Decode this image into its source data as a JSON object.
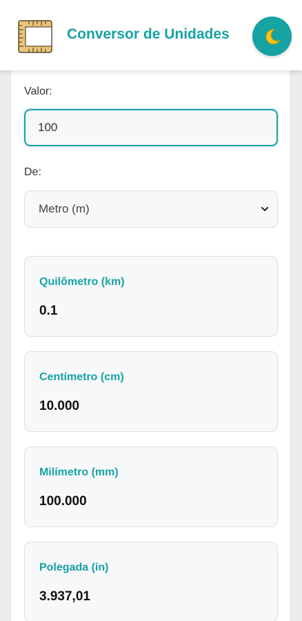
{
  "header": {
    "title": "Conversor de Unidades",
    "logo_icon": "ruler-icon",
    "theme_toggle_icon": "crescent-moon-icon"
  },
  "form": {
    "value_label": "Valor:",
    "value": "100",
    "from_label": "De:",
    "from_selected": "Metro (m)"
  },
  "results": [
    {
      "unit": "Quilômetro (km)",
      "value": "0.1"
    },
    {
      "unit": "Centímetro (cm)",
      "value": "10.000"
    },
    {
      "unit": "Milímetro (mm)",
      "value": "100.000"
    },
    {
      "unit": "Polegada (in)",
      "value": "3.937,01"
    }
  ],
  "colors": {
    "accent": "#17a2a4",
    "background": "#ececec",
    "card": "#ffffff",
    "result_bg": "#f7f8fa",
    "moon": "#f5c518"
  }
}
